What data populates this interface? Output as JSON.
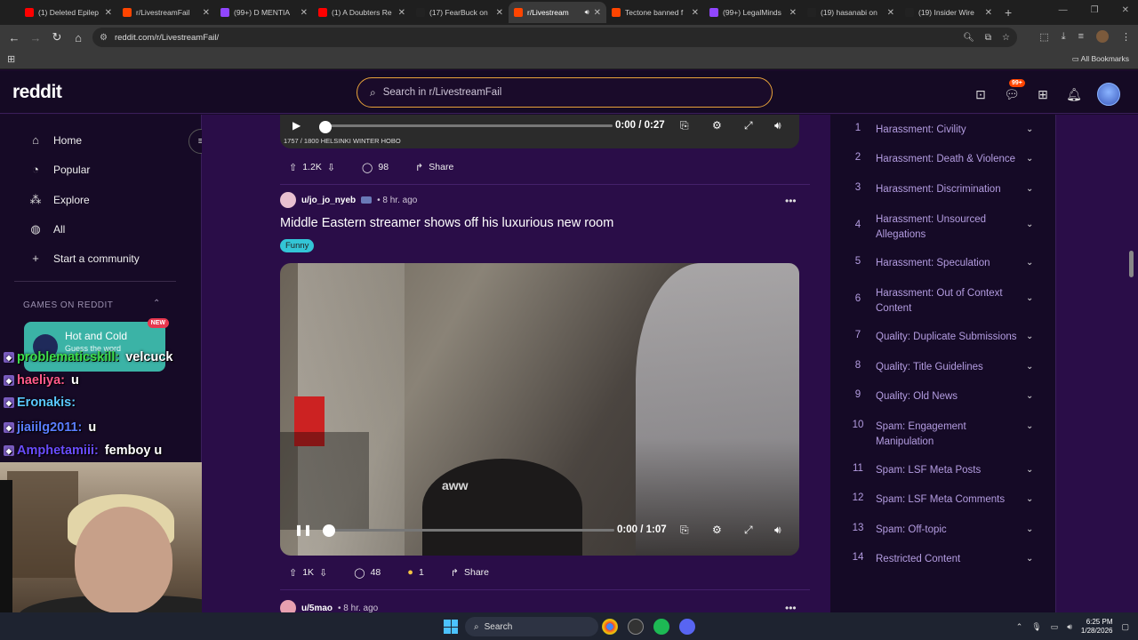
{
  "browser": {
    "tabs": [
      {
        "label": "(1) Deleted Epilep",
        "favcolor": "#ff0000",
        "active": false
      },
      {
        "label": "r/LivestreamFail",
        "favcolor": "#ff4500",
        "active": false
      },
      {
        "label": "(99+) D MENTIA",
        "favcolor": "#9146ff",
        "active": false
      },
      {
        "label": "(1) A Doubters Re",
        "favcolor": "#ff0000",
        "active": false
      },
      {
        "label": "(17) FearBuck on",
        "favcolor": "#222222",
        "active": false
      },
      {
        "label": "r/Livestream",
        "favcolor": "#ff4500",
        "active": true
      },
      {
        "label": "Tectone banned f",
        "favcolor": "#ff4500",
        "active": false
      },
      {
        "label": "(99+) LegalMinds",
        "favcolor": "#9146ff",
        "active": false
      },
      {
        "label": "(19) hasanabi on",
        "favcolor": "#222222",
        "active": false
      },
      {
        "label": "(19) Insider Wire",
        "favcolor": "#222222",
        "active": false
      }
    ],
    "url": "reddit.com/r/LivestreamFail/",
    "all_bookmarks": "All Bookmarks"
  },
  "header": {
    "logo": "reddit",
    "search_placeholder": "Search in r/LivestreamFail",
    "notif_badge": "99+"
  },
  "sidebar": {
    "items": [
      {
        "label": "Home",
        "icon": "home-icon"
      },
      {
        "label": "Popular",
        "icon": "popular-icon"
      },
      {
        "label": "Explore",
        "icon": "explore-icon"
      },
      {
        "label": "All",
        "icon": "all-icon"
      },
      {
        "label": "Start a community",
        "icon": "plus-icon"
      }
    ],
    "games_header": "GAMES ON REDDIT",
    "game_card": {
      "title": "Hot and Cold",
      "subtitle": "Guess the word",
      "badge": "NEW"
    }
  },
  "chat_overlay": [
    {
      "user": "problematicskill:",
      "msg": "velcuck",
      "color": "#3ee04a"
    },
    {
      "user": "haeliya:",
      "msg": "u",
      "color": "#ff5a8a"
    },
    {
      "user": "Eronakis:",
      "msg": "",
      "color": "#5ac8ff"
    },
    {
      "user": "jiaiilg2011:",
      "msg": "u",
      "color": "#5a7dff"
    },
    {
      "user": "Amphetamiii:",
      "msg": "femboy u",
      "color": "#6a4cff"
    }
  ],
  "feed": {
    "video1": {
      "time": "0:00 / 0:27",
      "info": "1757 / 1800 HELSINKI WINTER HOBO"
    },
    "post1_actions": {
      "votes": "1.2K",
      "comments": "98",
      "share": "Share"
    },
    "post2": {
      "user": "u/jo_jo_nyeb",
      "age": "• 8 hr. ago",
      "title": "Middle Eastern streamer shows off his luxurious new room",
      "flair": "Funny",
      "video_time": "0:00 / 1:07",
      "video_watermark": "aww"
    },
    "post2_actions": {
      "votes": "1K",
      "comments": "48",
      "awards": "1",
      "share": "Share"
    },
    "post3": {
      "user": "u/5mao",
      "age": "• 8 hr. ago"
    }
  },
  "rules": [
    {
      "num": "1",
      "text": "Harassment: Civility"
    },
    {
      "num": "2",
      "text": "Harassment: Death & Violence"
    },
    {
      "num": "3",
      "text": "Harassment: Discrimination"
    },
    {
      "num": "4",
      "text": "Harassment: Unsourced Allegations"
    },
    {
      "num": "5",
      "text": "Harassment: Speculation"
    },
    {
      "num": "6",
      "text": "Harassment: Out of Context Content"
    },
    {
      "num": "7",
      "text": "Quality: Duplicate Submissions"
    },
    {
      "num": "8",
      "text": "Quality: Title Guidelines"
    },
    {
      "num": "9",
      "text": "Quality: Old News"
    },
    {
      "num": "10",
      "text": "Spam: Engagement Manipulation"
    },
    {
      "num": "11",
      "text": "Spam: LSF Meta Posts"
    },
    {
      "num": "12",
      "text": "Spam: LSF Meta Comments"
    },
    {
      "num": "13",
      "text": "Spam: Off-topic"
    },
    {
      "num": "14",
      "text": "Restricted Content"
    }
  ],
  "taskbar": {
    "search": "Search",
    "time": "6:25 PM",
    "date": "1/28/2026"
  }
}
